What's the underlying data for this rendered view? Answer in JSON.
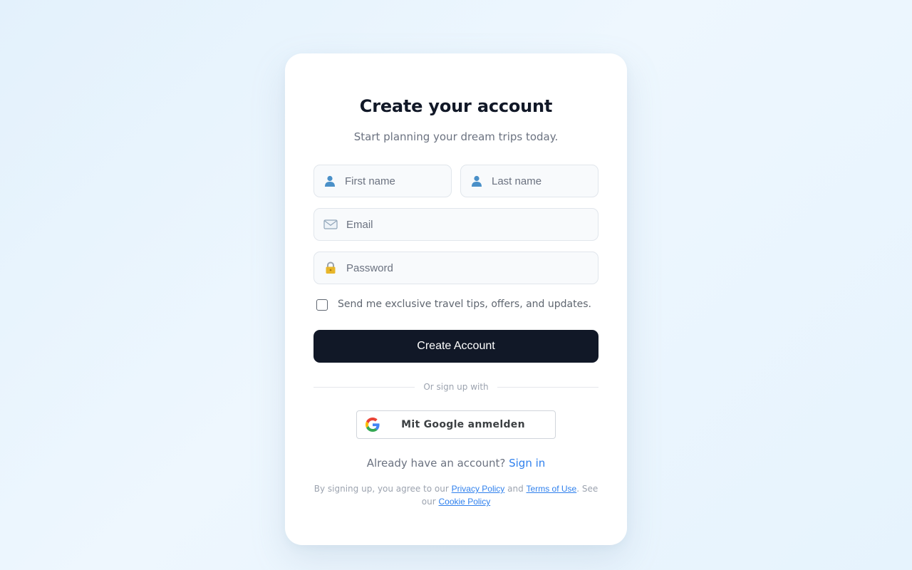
{
  "card": {
    "title": "Create your account",
    "subtitle": "Start planning your dream trips today."
  },
  "form": {
    "first_name": {
      "placeholder": "First name",
      "value": "",
      "icon": "user-icon"
    },
    "last_name": {
      "placeholder": "Last name",
      "value": "",
      "icon": "user-icon"
    },
    "email": {
      "placeholder": "Email",
      "value": "",
      "icon": "envelope-icon"
    },
    "password": {
      "placeholder": "Password",
      "value": "",
      "icon": "lock-icon"
    },
    "newsletter": {
      "label": "Send me exclusive travel tips, offers, and updates.",
      "checked": false
    },
    "submit_label": "Create Account"
  },
  "social": {
    "divider_text": "Or sign up with",
    "google_label": "Mit Google anmelden"
  },
  "signin": {
    "prompt": "Already have an account?",
    "link": "Sign in"
  },
  "legal": {
    "prefix": "By signing up, you agree to our",
    "privacy": "Privacy Policy",
    "and": "and",
    "terms": "Terms of Use",
    "see": ". See our",
    "cookie": "Cookie Policy"
  },
  "colors": {
    "primary_button": "#111827",
    "link": "#2f80ed",
    "background": "#e8f4fd"
  }
}
